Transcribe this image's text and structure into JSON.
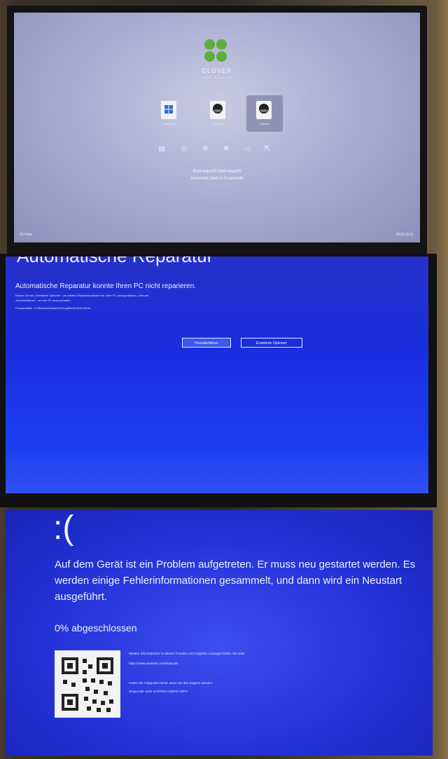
{
  "clover": {
    "title": "CLOVER",
    "subtitle": "BOOT MANAGER",
    "entries": [
      {
        "label": "Windows"
      },
      {
        "label": "Lenovo"
      },
      {
        "label": "Catalina"
      }
    ],
    "tool_icons": [
      "shell-icon",
      "about-icon",
      "options-icon",
      "help-icon",
      "back-icon",
      "exit-icon"
    ],
    "boot_line": "Boot macOS from macOS",
    "autoboot_line": "Automatic boot in 9 seconds",
    "help_key": "F1:Help",
    "version": "r5123 (5.1)"
  },
  "repair": {
    "heading": "Automatische Reparatur",
    "message": "Automatische Reparatur konnte Ihren PC nicht reparieren.",
    "hint_line1": "Klicken Sie auf „Erweiterte Optionen\", um weitere Reparaturoptionen für Ihren PC auszuprobieren, oder auf",
    "hint_line2": "„Herunterfahren\", um den PC auszuschalten.",
    "logfile": "Protokolldatei: C:\\Windows\\System32\\Logfiles\\Srt\\SrtTrail.txt",
    "shutdown_label": "Herunterfahren",
    "advanced_label": "Erweiterte Optionen"
  },
  "bsod": {
    "frown": ":(",
    "message": "Auf dem Gerät ist ein Problem aufgetreten. Er muss neu gestartet werden. Es werden einige Fehlerinformationen gesammelt, und dann wird ein Neustart ausgeführt.",
    "progress": "0% abgeschlossen",
    "info_line1": "Weitere Informationen zu diesem Problem und mögliche Lösungen finden Sie unter",
    "info_url": "https://www.windows.com/stopcode",
    "support_line": "Halten Sie Folgendes bereit, wenn Sie den Support anrufen:",
    "stopcode": "Stoppcode: BAD SYSTEM CONFIG INFO"
  },
  "colors": {
    "clover_bg": "#a6a9cf",
    "repair_bg": "#1a2ee0",
    "bsod_bg": "#2333d8",
    "clover_green": "#5fae3a"
  }
}
